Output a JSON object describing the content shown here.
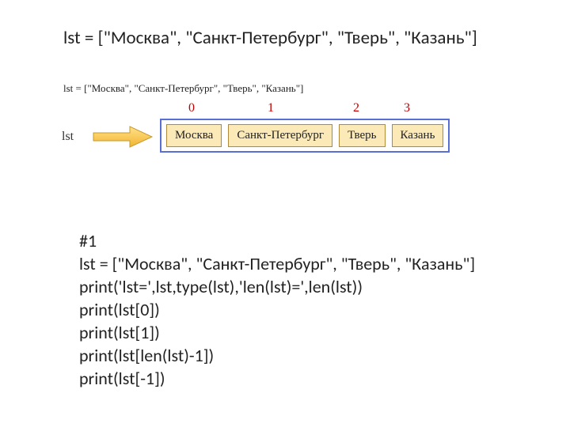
{
  "heading": "lst = [\"Москва\", \"Санкт-Петербург\", \"Тверь\", \"Казань\"]",
  "small_code": "lst = [\"Москва\", \"Санкт-Петербург\", \"Тверь\", \"Казань\"]",
  "diagram": {
    "var_label": "lst",
    "indices": [
      "0",
      "1",
      "2",
      "3"
    ],
    "cells": [
      "Москва",
      "Санкт-Петербург",
      "Тверь",
      "Казань"
    ]
  },
  "code": {
    "l1": "#1",
    "l2": "lst = [\"Москва\", \"Санкт-Петербург\", \"Тверь\", \"Казань\"]",
    "l3": "print('lst=',lst,type(lst),'len(lst)=',len(lst))",
    "l4": "print(lst[0])",
    "l5": "print(lst[1])",
    "l6": "print(lst[len(lst)-1])",
    "l7": "print(lst[-1])"
  }
}
